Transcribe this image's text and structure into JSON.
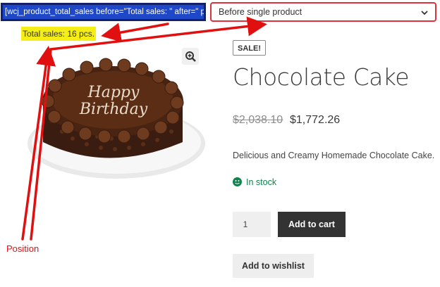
{
  "shortcode": {
    "text": "[wcj_product_total_sales before=\"Total sales: \" after=\" pcs.\"]"
  },
  "position_select": {
    "selected": "Before single product"
  },
  "total_sales": {
    "text": "Total sales: 16 pcs."
  },
  "product": {
    "image_text_line1": "Happy",
    "image_text_line2": "Birthday",
    "sale_badge": "SALE!",
    "title": "Chocolate Cake",
    "old_price": "$2,038.10",
    "new_price": "$1,772.26",
    "description": "Delicious and Creamy Homemade Chocolate Cake.",
    "stock": "In stock",
    "quantity": "1",
    "add_to_cart": "Add to cart",
    "add_to_wishlist": "Add to wishlist"
  },
  "annotation": {
    "label": "Position",
    "color": "#e01010"
  },
  "colors": {
    "shortcode_bg": "#1f48c9",
    "highlight": "#f5ee16",
    "stock_green": "#0f834d",
    "button_dark": "#333333"
  },
  "icons": {
    "zoom": "magnifier-plus-icon",
    "chevron": "chevron-down-icon",
    "stock": "smiley-icon"
  }
}
